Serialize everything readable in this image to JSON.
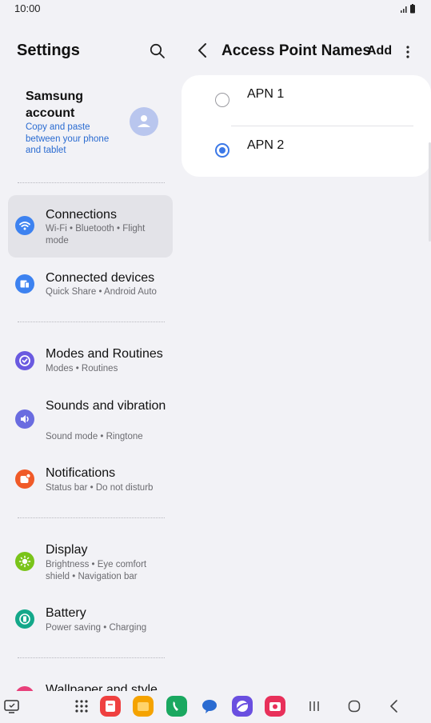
{
  "status_bar": {
    "time": "10:00",
    "icons": [
      "signal-icon",
      "battery-icon"
    ]
  },
  "left_pane": {
    "title": "Settings",
    "search_icon": "search-icon",
    "account": {
      "name": "Samsung account",
      "subtitle": "Copy and paste between your phone and tablet",
      "avatar_icon": "person-icon"
    },
    "items": [
      {
        "label": "Connections",
        "subtitle": "Wi-Fi • Bluetooth • Flight mode",
        "icon": "wifi-icon",
        "color": "#3d82f0",
        "selected": true
      },
      {
        "label": "Connected devices",
        "subtitle": "Quick Share • Android Auto",
        "icon": "devices-icon",
        "color": "#3d82f0",
        "selected": false
      },
      {
        "label": "Modes and Routines",
        "subtitle": "Modes • Routines",
        "icon": "routines-icon",
        "color": "#6a5ae0",
        "selected": false
      },
      {
        "label": "Sounds and vibration",
        "subtitle": "Sound mode • Ringtone",
        "icon": "volume-icon",
        "color": "#6a6ce0",
        "selected": false
      },
      {
        "label": "Notifications",
        "subtitle": "Status bar • Do not disturb",
        "icon": "notification-icon",
        "color": "#f05a28",
        "selected": false
      },
      {
        "label": "Display",
        "subtitle": "Brightness • Eye comfort shield • Navigation bar",
        "icon": "brightness-icon",
        "color": "#7ac41a",
        "selected": false
      },
      {
        "label": "Battery",
        "subtitle": "Power saving • Charging",
        "icon": "battery-settings-icon",
        "color": "#14a88a",
        "selected": false
      },
      {
        "label": "Wallpaper and style",
        "subtitle": "",
        "icon": "wallpaper-icon",
        "color": "#e8407a",
        "selected": false
      }
    ]
  },
  "right_pane": {
    "title": "Access Point Names",
    "add_label": "Add",
    "back_icon": "back-arrow-icon",
    "more_icon": "more-vert-icon",
    "apns": [
      {
        "name": "APN 1",
        "selected": false
      },
      {
        "name": "APN 2",
        "selected": true
      }
    ]
  },
  "nav_bar": {
    "accent": "#3b78e7",
    "items": [
      "screenshot-icon",
      "apps-grid-icon",
      "notes-app-icon",
      "files-app-icon",
      "phone-app-icon",
      "messages-app-icon",
      "browser-app-icon",
      "camera-app-icon",
      "recents-icon",
      "home-icon",
      "back-icon"
    ]
  }
}
